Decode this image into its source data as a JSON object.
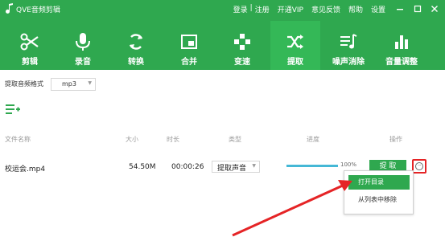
{
  "app": {
    "title": "QVE音频剪辑"
  },
  "topmenu": {
    "login": "登录",
    "separator": "|",
    "register": "注册",
    "vip": "开通VIP",
    "feedback": "意见反馈",
    "help": "帮助",
    "settings": "设置"
  },
  "toolbar": {
    "items": [
      {
        "label": "剪辑",
        "icon": "scissors-icon"
      },
      {
        "label": "录音",
        "icon": "microphone-icon"
      },
      {
        "label": "转换",
        "icon": "convert-icon"
      },
      {
        "label": "合并",
        "icon": "merge-icon"
      },
      {
        "label": "变速",
        "icon": "speed-icon"
      },
      {
        "label": "提取",
        "icon": "shuffle-icon"
      },
      {
        "label": "噪声消除",
        "icon": "noise-icon"
      },
      {
        "label": "音量调整",
        "icon": "volume-bars-icon"
      }
    ],
    "active": "提取"
  },
  "format": {
    "label": "提取音频格式",
    "value": "mp3"
  },
  "table": {
    "headers": {
      "name": "文件名称",
      "size": "大小",
      "duration": "时长",
      "type": "类型",
      "progress": "进度",
      "action": "操作"
    },
    "rows": [
      {
        "name": "校运会.mp4",
        "size": "54.50M",
        "duration": "00:00:26",
        "type": "提取声音",
        "progress": 1.0,
        "progress_text": "100%",
        "action": "提 取"
      }
    ]
  },
  "more_menu": {
    "symbol": "···",
    "items": [
      {
        "label": "打开目录",
        "highlighted": true
      },
      {
        "label": "从列表中移除",
        "highlighted": false
      }
    ]
  },
  "colors": {
    "brand_green": "#2fa84f",
    "annotation_red": "#e52426",
    "progress_blue": "#45b8d6"
  }
}
